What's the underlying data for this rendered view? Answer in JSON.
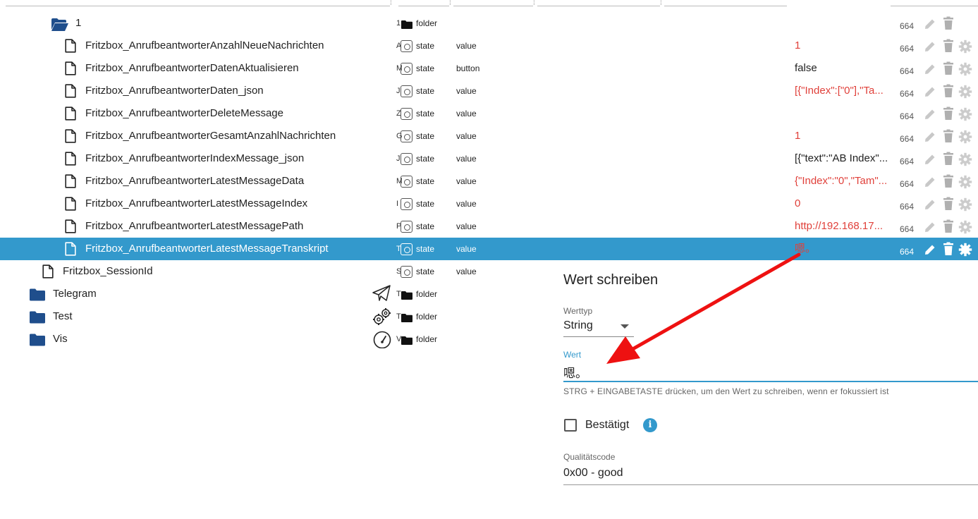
{
  "rows": [
    {
      "id": "r1",
      "name": "1",
      "kind": "folder-open",
      "trunc": "1",
      "type": "folder",
      "role": "",
      "value": "",
      "value_red": false,
      "acl": "664",
      "has_settings": false
    },
    {
      "id": "r2",
      "name": "Fritzbox_AnrufbeantworterAnzahlNeueNachrichten",
      "kind": "file",
      "trunc": "A",
      "type": "state",
      "role": "value",
      "value": "1",
      "value_red": true,
      "acl": "664",
      "has_settings": true
    },
    {
      "id": "r3",
      "name": "Fritzbox_AnrufbeantworterDatenAktualisieren",
      "kind": "file",
      "trunc": "M",
      "type": "state",
      "role": "button",
      "value": "false",
      "value_red": false,
      "acl": "664",
      "has_settings": true
    },
    {
      "id": "r4",
      "name": "Fritzbox_AnrufbeantworterDaten_json",
      "kind": "file",
      "trunc": "J",
      "type": "state",
      "role": "value",
      "value": "[{\"Index\":[\"0\"],\"Ta...",
      "value_red": true,
      "acl": "664",
      "has_settings": true
    },
    {
      "id": "r5",
      "name": "Fritzbox_AnrufbeantworterDeleteMessage",
      "kind": "file",
      "trunc": "Z",
      "type": "state",
      "role": "value",
      "value": "",
      "value_red": false,
      "acl": "664",
      "has_settings": true
    },
    {
      "id": "r6",
      "name": "Fritzbox_AnrufbeantworterGesamtAnzahlNachrichten",
      "kind": "file",
      "trunc": "G",
      "type": "state",
      "role": "value",
      "value": "1",
      "value_red": true,
      "acl": "664",
      "has_settings": true
    },
    {
      "id": "r7",
      "name": "Fritzbox_AnrufbeantworterIndexMessage_json",
      "kind": "file",
      "trunc": "J",
      "type": "state",
      "role": "value",
      "value": "[{\"text\":\"AB Index\"...",
      "value_red": false,
      "acl": "664",
      "has_settings": true
    },
    {
      "id": "r8",
      "name": "Fritzbox_AnrufbeantworterLatestMessageData",
      "kind": "file",
      "trunc": "M",
      "type": "state",
      "role": "value",
      "value": "{\"Index\":\"0\",\"Tam\"...",
      "value_red": true,
      "acl": "664",
      "has_settings": true
    },
    {
      "id": "r9",
      "name": "Fritzbox_AnrufbeantworterLatestMessageIndex",
      "kind": "file",
      "trunc": "I",
      "type": "state",
      "role": "value",
      "value": "0",
      "value_red": true,
      "acl": "664",
      "has_settings": true
    },
    {
      "id": "r10",
      "name": "Fritzbox_AnrufbeantworterLatestMessagePath",
      "kind": "file",
      "trunc": "P",
      "type": "state",
      "role": "value",
      "value": "http://192.168.17...",
      "value_red": true,
      "acl": "664",
      "has_settings": true
    },
    {
      "id": "r11",
      "name": "Fritzbox_AnrufbeantworterLatestMessageTranskript",
      "kind": "file",
      "trunc": "T",
      "type": "state",
      "role": "value",
      "value": "嗯。",
      "value_red": true,
      "acl": "664",
      "has_settings": true,
      "selected": true
    },
    {
      "id": "r12",
      "name": "Fritzbox_SessionId",
      "kind": "file",
      "trunc": "S",
      "type": "state",
      "role": "value",
      "value": "",
      "value_red": false,
      "acl": "",
      "has_settings": false
    },
    {
      "id": "r13",
      "name": "Telegram",
      "kind": "folder",
      "trunc": "T",
      "type": "folder",
      "role": "",
      "value": "",
      "value_red": false,
      "acl": "",
      "has_settings": false,
      "app_icon": "telegram-plane-icon"
    },
    {
      "id": "r14",
      "name": "Test",
      "kind": "folder",
      "trunc": "T",
      "type": "folder",
      "role": "",
      "value": "",
      "value_red": false,
      "acl": "",
      "has_settings": false,
      "app_icon": "gears-icon"
    },
    {
      "id": "r15",
      "name": "Vis",
      "kind": "folder",
      "trunc": "V",
      "type": "folder",
      "role": "",
      "value": "",
      "value_red": false,
      "acl": "",
      "has_settings": false,
      "app_icon": "gauge-icon"
    }
  ],
  "dialog": {
    "title": "Wert schreiben",
    "werttyp_label": "Werttyp",
    "werttyp_value": "String",
    "wert_label": "Wert",
    "wert_value": "嗯。",
    "helper": "STRG + EINGABETASTE drücken, um den Wert zu schreiben, wenn er fokussiert ist",
    "bestaetigt_label": "Bestätigt",
    "info_glyph": "i",
    "quality_label": "Qualitätscode",
    "quality_value": "0x00 - good"
  },
  "colors": {
    "selected_bg": "#3399cc",
    "value_red": "#e0403a",
    "folder_blue": "#1f4e8c",
    "annotation_arrow": "#ee1111"
  }
}
